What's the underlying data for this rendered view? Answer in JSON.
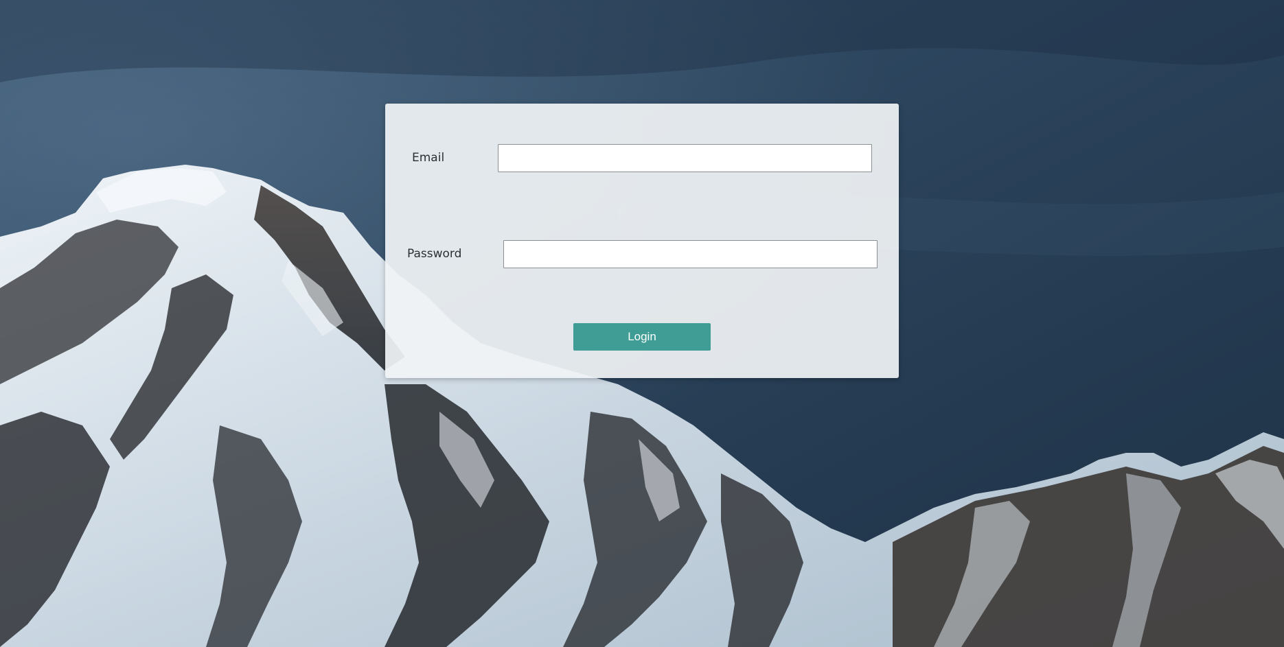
{
  "login_form": {
    "email_label": "Email",
    "email_value": "",
    "email_placeholder": "",
    "password_label": "Password",
    "password_value": "",
    "password_placeholder": "",
    "submit_label": "Login"
  },
  "colors": {
    "button_accent": "#3f9d96",
    "card_background": "#f0f3f5",
    "sky": "#2b4259",
    "rock": "#2a2c30",
    "snow": "#e8eef3"
  },
  "background": {
    "scene": "mountain-background-image"
  }
}
